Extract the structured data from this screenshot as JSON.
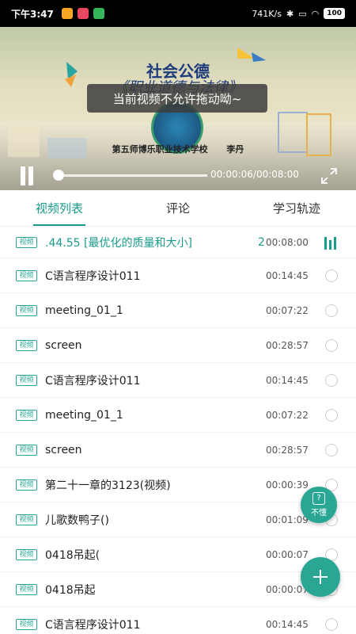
{
  "status_bar": {
    "time": "下午3:47",
    "network_speed": "741K/s",
    "battery": "100"
  },
  "video": {
    "title": "社会公德",
    "subtitle": "《职业道德与法律》",
    "school": "第五师博乐职业技术学校",
    "teacher": "李丹",
    "toast": "当前视频不允许拖动呦~",
    "time_display": "00:00:06/00:08:00",
    "progress": 0.0125
  },
  "tabs": [
    {
      "label": "视频列表",
      "active": true
    },
    {
      "label": "评论",
      "active": false
    },
    {
      "label": "学习轨迹",
      "active": false
    }
  ],
  "playlist": [
    {
      "badge": "视频",
      "title": ".44.55 [最优化的质量和大小]",
      "title_tail": "2(",
      "duration": "00:08:00",
      "status": "playing-icon"
    },
    {
      "badge": "视频",
      "title": "C语言程序设计011",
      "duration": "00:14:45",
      "status": "radio"
    },
    {
      "badge": "视频",
      "title": "meeting_01_1",
      "duration": "00:07:22",
      "status": "radio"
    },
    {
      "badge": "视频",
      "title": "screen",
      "duration": "00:28:57",
      "status": "radio"
    },
    {
      "badge": "视频",
      "title": "C语言程序设计011",
      "duration": "00:14:45",
      "status": "radio"
    },
    {
      "badge": "视频",
      "title": "meeting_01_1",
      "duration": "00:07:22",
      "status": "radio"
    },
    {
      "badge": "视频",
      "title": "screen",
      "duration": "00:28:57",
      "status": "radio"
    },
    {
      "badge": "视频",
      "title": "第二十一章的3123(视频)",
      "duration": "00:00:39",
      "status": "radio"
    },
    {
      "badge": "视频",
      "title": "儿歌数鸭子()",
      "duration": "00:01:09",
      "status": "radio"
    },
    {
      "badge": "视频",
      "title": "0418吊起(",
      "duration": "00:00:07",
      "status": "radio"
    },
    {
      "badge": "视频",
      "title": "0418吊起",
      "duration": "00:00:07",
      "status": "radio"
    },
    {
      "badge": "视频",
      "title": "C语言程序设计011",
      "duration": "00:14:45",
      "status": "radio"
    }
  ],
  "fab": {
    "dont_understand_label": "不懂",
    "add_icon": "plus-icon"
  },
  "colors": {
    "accent": "#1a9b8c",
    "badge": "#2aa794"
  }
}
